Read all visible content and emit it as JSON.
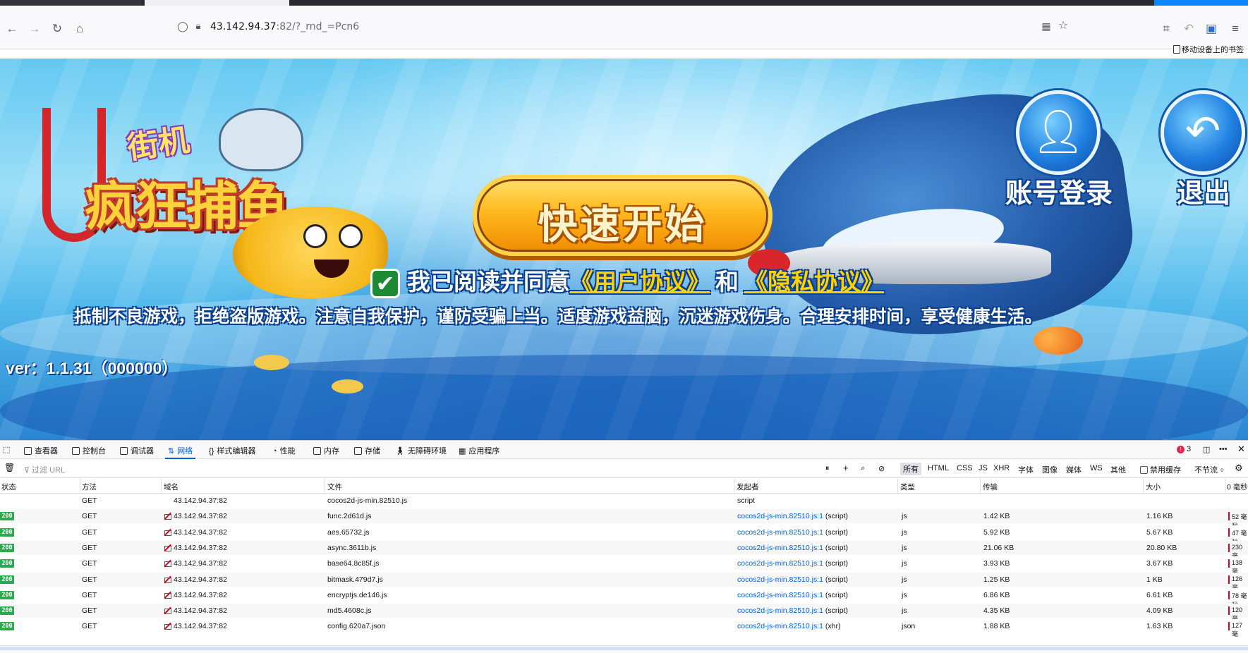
{
  "browser": {
    "url_main": "43.142.94.37",
    "url_rest": ":82/?_rnd_=Pcn6",
    "bookmarks_label": "移动设备上的书签"
  },
  "game": {
    "logo_top": "街机",
    "logo_main": "疯狂捕鱼",
    "start_label": "快速开始",
    "login_label": "账号登录",
    "exit_label": "退出",
    "agree_prefix": "我已阅读并同意",
    "user_agreement": "《用户协议》",
    "and_text": "和",
    "privacy_agreement": "《隐私协议》",
    "notice": "抵制不良游戏，拒绝盗版游戏。注意自我保护，谨防受骗上当。适度游戏益脑，沉迷游戏伤身。合理安排时间，享受健康生活。",
    "version": "ver：1.1.31（000000）"
  },
  "devtools": {
    "tabs": [
      "查看器",
      "控制台",
      "调试器",
      "网络",
      "样式编辑器",
      "性能",
      "内存",
      "存储",
      "无障碍环境",
      "应用程序"
    ],
    "error_count": "3",
    "filter_placeholder": "过滤 URL",
    "type_filters": [
      "所有",
      "HTML",
      "CSS",
      "JS",
      "XHR",
      "字体",
      "图像",
      "媒体",
      "WS",
      "其他"
    ],
    "disable_cache": "禁用缓存",
    "throttle": "不节流 ÷",
    "columns": [
      "状态",
      "方法",
      "域名",
      "文件",
      "发起者",
      "类型",
      "传输",
      "大小",
      "0 毫秒"
    ],
    "rows": [
      {
        "status": "",
        "method": "GET",
        "domain": "43.142.94.37:82",
        "file": "cocos2d-js-min.82510.js",
        "initiator": "script",
        "type": "",
        "transfer": "",
        "size": "",
        "waterfall": ""
      },
      {
        "status": "200",
        "method": "GET",
        "domain": "43.142.94.37:82",
        "file": "func.2d61d.js",
        "initiator": "cocos2d-js-min.82510.js:1",
        "initiator_suffix": "(script)",
        "type": "js",
        "transfer": "1.42 KB",
        "size": "1.16 KB",
        "waterfall": "52 毫秒"
      },
      {
        "status": "200",
        "method": "GET",
        "domain": "43.142.94.37:82",
        "file": "aes.65732.js",
        "initiator": "cocos2d-js-min.82510.js:1",
        "initiator_suffix": "(script)",
        "type": "js",
        "transfer": "5.92 KB",
        "size": "5.67 KB",
        "waterfall": "47 毫秒"
      },
      {
        "status": "200",
        "method": "GET",
        "domain": "43.142.94.37:82",
        "file": "async.3611b.js",
        "initiator": "cocos2d-js-min.82510.js:1",
        "initiator_suffix": "(script)",
        "type": "js",
        "transfer": "21.06 KB",
        "size": "20.80 KB",
        "waterfall": "230 毫"
      },
      {
        "status": "200",
        "method": "GET",
        "domain": "43.142.94.37:82",
        "file": "base64.8c85f.js",
        "initiator": "cocos2d-js-min.82510.js:1",
        "initiator_suffix": "(script)",
        "type": "js",
        "transfer": "3.93 KB",
        "size": "3.67 KB",
        "waterfall": "138 毫"
      },
      {
        "status": "200",
        "method": "GET",
        "domain": "43.142.94.37:82",
        "file": "bitmask.479d7.js",
        "initiator": "cocos2d-js-min.82510.js:1",
        "initiator_suffix": "(script)",
        "type": "js",
        "transfer": "1.25 KB",
        "size": "1 KB",
        "waterfall": "126 毫"
      },
      {
        "status": "200",
        "method": "GET",
        "domain": "43.142.94.37:82",
        "file": "encryptjs.de146.js",
        "initiator": "cocos2d-js-min.82510.js:1",
        "initiator_suffix": "(script)",
        "type": "js",
        "transfer": "6.86 KB",
        "size": "6.61 KB",
        "waterfall": "78 毫秒"
      },
      {
        "status": "200",
        "method": "GET",
        "domain": "43.142.94.37:82",
        "file": "md5.4608c.js",
        "initiator": "cocos2d-js-min.82510.js:1",
        "initiator_suffix": "(script)",
        "type": "js",
        "transfer": "4.35 KB",
        "size": "4.09 KB",
        "waterfall": "120 毫"
      },
      {
        "status": "200",
        "method": "GET",
        "domain": "43.142.94.37:82",
        "file": "config.620a7.json",
        "initiator": "cocos2d-js-min.82510.js:1",
        "initiator_suffix": "(xhr)",
        "type": "json",
        "transfer": "1.88 KB",
        "size": "1.63 KB",
        "waterfall": "127 毫"
      }
    ]
  },
  "colors": {
    "accent": "#0061e0",
    "status_ok": "#2ca94e",
    "start_button": "#ffb81d"
  }
}
